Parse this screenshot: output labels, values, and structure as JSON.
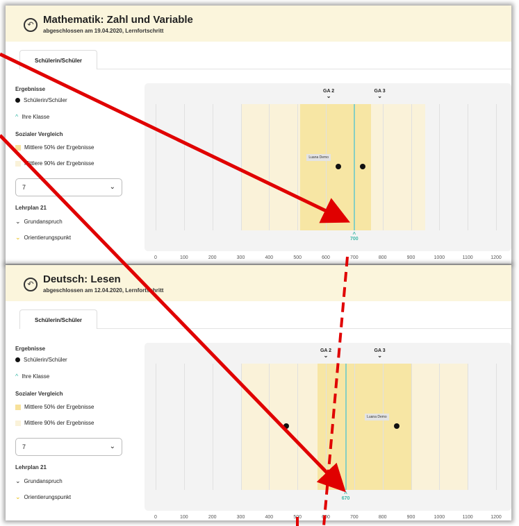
{
  "panels": [
    {
      "title": "Mathematik: Zahl und Variable",
      "subtitle": "abgeschlossen am 19.04.2020, Lernfortschritt",
      "tab": "Schülerin/Schüler",
      "legend": {
        "results_heading": "Ergebnisse",
        "student": "Schülerin/Schüler",
        "class": "Ihre Klasse",
        "social_heading": "Sozialer Vergleich",
        "middle50": "Mittlere 50% der Ergebnisse",
        "middle90": "Mittlere 90% der Ergebnisse",
        "select_value": "7",
        "lehrplan_heading": "Lehrplan 21",
        "grund": "Grundanspruch",
        "orient": "Orientierungspunkt"
      },
      "chart_data": {
        "type": "scatter",
        "xlim": [
          0,
          1200
        ],
        "ticks": [
          "0",
          "100",
          "200",
          "300",
          "400",
          "500",
          "600",
          "700",
          "800",
          "900",
          "1000",
          "1100",
          "1200"
        ],
        "band90": [
          300,
          950
        ],
        "band50": [
          510,
          760
        ],
        "class_value": 700,
        "class_label": "700",
        "markers": [
          {
            "label": "GA 2",
            "x": 610
          },
          {
            "label": "GA 3",
            "x": 790
          }
        ],
        "points": [
          {
            "x": 645
          },
          {
            "x": 730
          }
        ],
        "point_label": "Luana Demo"
      }
    },
    {
      "title": "Deutsch: Lesen",
      "subtitle": "abgeschlossen am 12.04.2020, Lernfortschritt",
      "tab": "Schülerin/Schüler",
      "legend": {
        "results_heading": "Ergebnisse",
        "student": "Schülerin/Schüler",
        "class": "Ihre Klasse",
        "social_heading": "Sozialer Vergleich",
        "middle50": "Mittlere 50% der Ergebnisse",
        "middle90": "Mittlere 90% der Ergebnisse",
        "select_value": "7",
        "lehrplan_heading": "Lehrplan 21",
        "grund": "Grundanspruch",
        "orient": "Orientierungspunkt"
      },
      "chart_data": {
        "type": "scatter",
        "xlim": [
          0,
          1200
        ],
        "ticks": [
          "0",
          "100",
          "200",
          "300",
          "400",
          "500",
          "600",
          "700",
          "800",
          "900",
          "1000",
          "1100",
          "1200"
        ],
        "band90": [
          300,
          1100
        ],
        "band50": [
          570,
          900
        ],
        "class_value": 670,
        "class_label": "670",
        "markers": [
          {
            "label": "GA 2",
            "x": 600
          },
          {
            "label": "GA 3",
            "x": 790
          }
        ],
        "points": [
          {
            "x": 460
          },
          {
            "x": 850
          }
        ],
        "point_label": "Luana Demo"
      }
    }
  ],
  "colors": {
    "accent_arrow": "#e00000",
    "teal": "#3cb8a8",
    "band50": "#f7e19a",
    "band90": "#faf2d9"
  }
}
